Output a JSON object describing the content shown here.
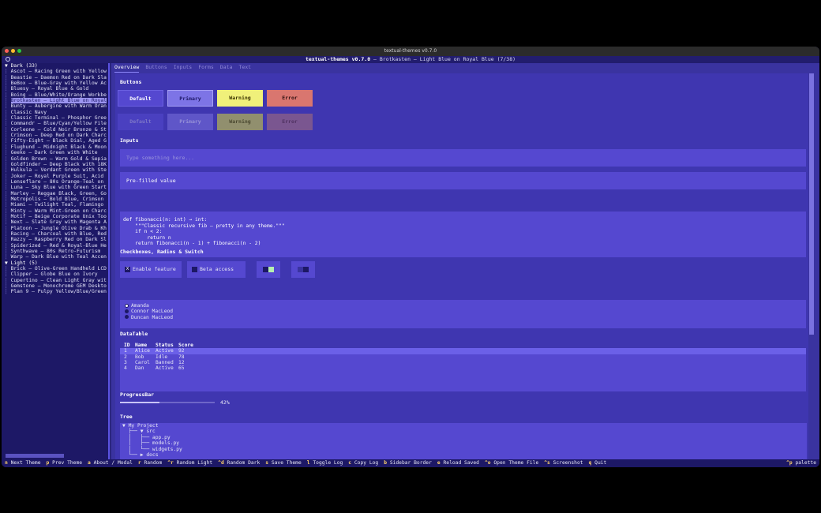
{
  "window": {
    "title": "textual-themes v0.7.0"
  },
  "header": {
    "app_name": "textual-themes v0.7.0",
    "subtitle": " — Brotkasten — Light Blue on Royal Blue  (7/38)"
  },
  "sidebar": {
    "lines": [
      {
        "text": "▼ Dark  (33)",
        "group": true
      },
      {
        "text": "Ascot — Racing Green with Yellow"
      },
      {
        "text": "Beastie — Daemon Red on Dark Sla"
      },
      {
        "text": "BeBox — Blue-Gray with Yellow Ac"
      },
      {
        "text": "Bluesy — Royal Blue & Gold"
      },
      {
        "text": "Boing — Blue/White/Orange Workbe"
      },
      {
        "text": "Brotkasten — Light Blue on Royal",
        "selected": true
      },
      {
        "text": "Bunty — Aubergine with Warm Oran"
      },
      {
        "text": "Classic Navy"
      },
      {
        "text": "Classic Terminal — Phosphor Gree"
      },
      {
        "text": "Commandr — Blue/Cyan/Yellow File"
      },
      {
        "text": "Corleone — Cold Noir Bronze & St"
      },
      {
        "text": "Crimson — Deep Red on Dark Charc"
      },
      {
        "text": "Fifty-Eight — Black Dial, Aged G"
      },
      {
        "text": "Flughund — Midnight Black & Moon"
      },
      {
        "text": "Geeko — Dark Green with White"
      },
      {
        "text": "Golden Brown — Warm Gold & Sepia"
      },
      {
        "text": "Goldfinder — Deep Black with 18K"
      },
      {
        "text": "Hulkula — Verdant Green with Ste"
      },
      {
        "text": "Joker — Royal Purple Suit, Acid"
      },
      {
        "text": "Lenseflare — 80s Orange-Teal on"
      },
      {
        "text": "Luna — Sky Blue with Green Start"
      },
      {
        "text": "Marley — Reggae Black, Green, Go"
      },
      {
        "text": "Metropolis — Bold Blue, Crimson"
      },
      {
        "text": "Miami — Twilight Teal, Flamingo"
      },
      {
        "text": "Minty — Warm Mint-Green on Charc"
      },
      {
        "text": "Motif — Beige Corporate Unix Too"
      },
      {
        "text": "Next — Slate Gray with Magenta A"
      },
      {
        "text": "Platoon — Jungle Olive Drab & Kh"
      },
      {
        "text": "Racing — Charcoal with Blue, Red"
      },
      {
        "text": "Razzy — Raspberry Red on Dark Sl"
      },
      {
        "text": "Spiderized — Red & Royal-Blue He"
      },
      {
        "text": "Synthwave — 80s Retro-Futurism"
      },
      {
        "text": "Warp — Dark Blue with Teal Accen"
      },
      {
        "text": "▼ Light  (5)",
        "group": true
      },
      {
        "text": "Brick — Olive-Green Handheld LCD"
      },
      {
        "text": "Clipper — Globe Blue on Ivory"
      },
      {
        "text": "Cupertino — Clean Light Gray wit"
      },
      {
        "text": "Gemstone — Monochrome GEM Deskto"
      },
      {
        "text": "Plan 9 — Pulpy Yellow/Blue/Green"
      }
    ]
  },
  "tabs": [
    "Overview",
    "Buttons",
    "Inputs",
    "Forms",
    "Data",
    "Text"
  ],
  "sections": {
    "buttons": "Buttons",
    "inputs": "Inputs",
    "checks": "Checkboxes, Radios & Switch",
    "datatable": "DataTable",
    "progress": "ProgressBar",
    "tree": "Tree"
  },
  "buttons": {
    "default": "Default",
    "primary": "Primary",
    "warning": "Warning",
    "error": "Error"
  },
  "inputs": {
    "placeholder": "Type something here...",
    "prefilled": "Pre-filled value"
  },
  "code": "def fibonacci(n: int) → int:\n    \"\"\"Classic recursive fib — pretty in any theme.\"\"\"\n    if n < 2:\n        return n\n    return fibonacci(n - 1) + fibonacci(n - 2)",
  "checkboxes": {
    "enable": {
      "label": "Enable feature",
      "mark": "X"
    },
    "beta": {
      "label": "Beta access"
    }
  },
  "radios": [
    "Amanda",
    "Connor MacLeod",
    "Duncan MacLeod"
  ],
  "table": {
    "headers": [
      "ID",
      "Name",
      "Status",
      "Score"
    ],
    "rows": [
      [
        "1",
        "Alice",
        "Active",
        "92"
      ],
      [
        "2",
        "Bob",
        "Idle",
        "78"
      ],
      [
        "3",
        "Carol",
        "Banned",
        "12"
      ],
      [
        "4",
        "Dan",
        "Active",
        "65"
      ]
    ]
  },
  "progress": {
    "value": 0.42,
    "label": "42%"
  },
  "tree": "▼ My Project\n  ├── ▼ src\n  │   ├── app.py\n  │   ├── models.py\n  │   └── widgets.py\n  └── ▶ docs",
  "footer": {
    "items": [
      {
        "key": "n",
        "label": "Next Theme"
      },
      {
        "key": "p",
        "label": "Prev Theme"
      },
      {
        "key": "a",
        "label": "About / Modal"
      },
      {
        "key": "r",
        "label": "Random"
      },
      {
        "key": "^r",
        "label": "Random Light"
      },
      {
        "key": "^d",
        "label": "Random Dark"
      },
      {
        "key": "s",
        "label": "Save Theme"
      },
      {
        "key": "l",
        "label": "Toggle Log"
      },
      {
        "key": "c",
        "label": "Copy Log"
      },
      {
        "key": "b",
        "label": "Sidebar Border"
      },
      {
        "key": "e",
        "label": "Reload Saved"
      },
      {
        "key": "^o",
        "label": "Open Theme File"
      },
      {
        "key": "^s",
        "label": "Screenshot"
      },
      {
        "key": "q",
        "label": "Quit"
      }
    ],
    "palette_key": "^p",
    "palette_label": "palette"
  },
  "colors": {
    "accent": "#8f88ff",
    "warning": "#f0f07a",
    "error": "#d9766f",
    "primary": "#7d74e6"
  }
}
